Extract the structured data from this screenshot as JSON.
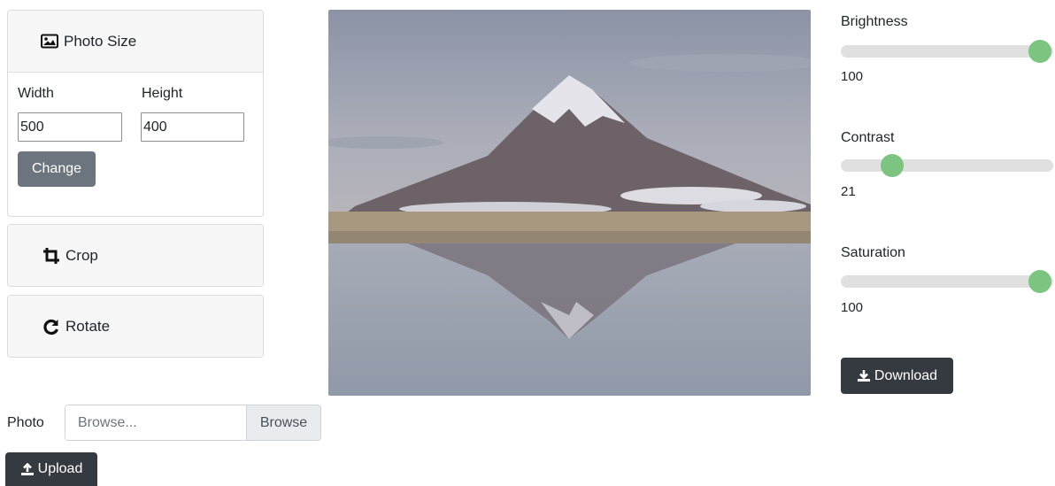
{
  "photo_size": {
    "title": "Photo Size",
    "width_label": "Width",
    "height_label": "Height",
    "width_value": "500",
    "height_value": "400",
    "change_button": "Change"
  },
  "crop": {
    "title": "Crop"
  },
  "rotate": {
    "title": "Rotate"
  },
  "sliders": {
    "brightness": {
      "label": "Brightness",
      "value": 100,
      "max": 100
    },
    "contrast": {
      "label": "Contrast",
      "value": 21,
      "max": 100
    },
    "saturation": {
      "label": "Saturation",
      "value": 100,
      "max": 100
    }
  },
  "download_button": "Download",
  "upload": {
    "label": "Photo",
    "placeholder": "Browse...",
    "browse_button": "Browse",
    "upload_button": "Upload"
  },
  "colors": {
    "slider_thumb": "#7cc47f",
    "slider_track": "#e0e0e0",
    "dark_button": "#343a40",
    "secondary_button": "#6c757d"
  }
}
